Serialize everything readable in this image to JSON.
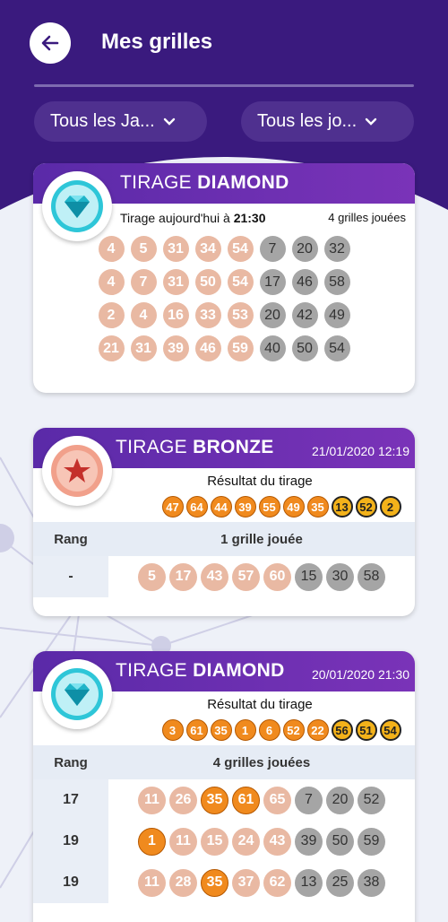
{
  "header": {
    "title": "Mes grilles",
    "filter_draws": "Tous les Ja...",
    "filter_days": "Tous les jo..."
  },
  "colors": {
    "header_bg": "#3a1a7e",
    "card_head": "#5a2aa8",
    "ball_pale": "#e9b9a3",
    "ball_grey": "#a5a5a5",
    "ball_orange": "#f08a1e",
    "ball_gold": "#f3b21a"
  },
  "cards": [
    {
      "name_light": "TIRAGE ",
      "name_bold": "DIAMOND",
      "icon": "diamond-icon",
      "sub_left_prefix": "Tirage aujourd'hui à ",
      "sub_left_time": "21:30",
      "sub_right": "4 grilles jouées",
      "grids": [
        {
          "main": [
            "4",
            "5",
            "31",
            "34",
            "54"
          ],
          "bonus": [
            "7",
            "20",
            "32"
          ]
        },
        {
          "main": [
            "4",
            "7",
            "31",
            "50",
            "54"
          ],
          "bonus": [
            "17",
            "46",
            "58"
          ]
        },
        {
          "main": [
            "2",
            "4",
            "16",
            "33",
            "53"
          ],
          "bonus": [
            "20",
            "42",
            "49"
          ]
        },
        {
          "main": [
            "21",
            "31",
            "39",
            "46",
            "59"
          ],
          "bonus": [
            "40",
            "50",
            "54"
          ]
        }
      ]
    },
    {
      "name_light": "TIRAGE ",
      "name_bold": "BRONZE",
      "icon": "star-icon",
      "date": "21/01/2020 12:19",
      "result_label": "Résultat du tirage",
      "result_main": [
        "47",
        "64",
        "44",
        "39",
        "55",
        "49",
        "35"
      ],
      "result_bonus": [
        "13",
        "52",
        "2"
      ],
      "rank_header": "Rang",
      "grids_label": "1 grille jouée",
      "rows": [
        {
          "rank": "-",
          "balls": [
            {
              "v": "5",
              "t": "pale"
            },
            {
              "v": "17",
              "t": "pale"
            },
            {
              "v": "43",
              "t": "pale"
            },
            {
              "v": "57",
              "t": "pale"
            },
            {
              "v": "60",
              "t": "pale"
            },
            {
              "v": "15",
              "t": "grey"
            },
            {
              "v": "30",
              "t": "grey"
            },
            {
              "v": "58",
              "t": "grey"
            }
          ]
        }
      ]
    },
    {
      "name_light": "TIRAGE ",
      "name_bold": "DIAMOND",
      "icon": "diamond-icon",
      "date": "20/01/2020 21:30",
      "result_label": "Résultat du tirage",
      "result_main": [
        "3",
        "61",
        "35",
        "1",
        "6",
        "52",
        "22"
      ],
      "result_bonus": [
        "56",
        "51",
        "54"
      ],
      "rank_header": "Rang",
      "grids_label": "4 grilles jouées",
      "rows": [
        {
          "rank": "17",
          "balls": [
            {
              "v": "11",
              "t": "pale"
            },
            {
              "v": "26",
              "t": "pale"
            },
            {
              "v": "35",
              "t": "orange"
            },
            {
              "v": "61",
              "t": "orange"
            },
            {
              "v": "65",
              "t": "pale"
            },
            {
              "v": "7",
              "t": "grey"
            },
            {
              "v": "20",
              "t": "grey"
            },
            {
              "v": "52",
              "t": "grey"
            }
          ]
        },
        {
          "rank": "19",
          "balls": [
            {
              "v": "1",
              "t": "orange"
            },
            {
              "v": "11",
              "t": "pale"
            },
            {
              "v": "15",
              "t": "pale"
            },
            {
              "v": "24",
              "t": "pale"
            },
            {
              "v": "43",
              "t": "pale"
            },
            {
              "v": "39",
              "t": "grey"
            },
            {
              "v": "50",
              "t": "grey"
            },
            {
              "v": "59",
              "t": "grey"
            }
          ]
        },
        {
          "rank": "19",
          "balls": [
            {
              "v": "11",
              "t": "pale"
            },
            {
              "v": "28",
              "t": "pale"
            },
            {
              "v": "35",
              "t": "orange"
            },
            {
              "v": "37",
              "t": "pale"
            },
            {
              "v": "62",
              "t": "pale"
            },
            {
              "v": "13",
              "t": "grey"
            },
            {
              "v": "25",
              "t": "grey"
            },
            {
              "v": "38",
              "t": "grey"
            }
          ]
        }
      ]
    }
  ]
}
